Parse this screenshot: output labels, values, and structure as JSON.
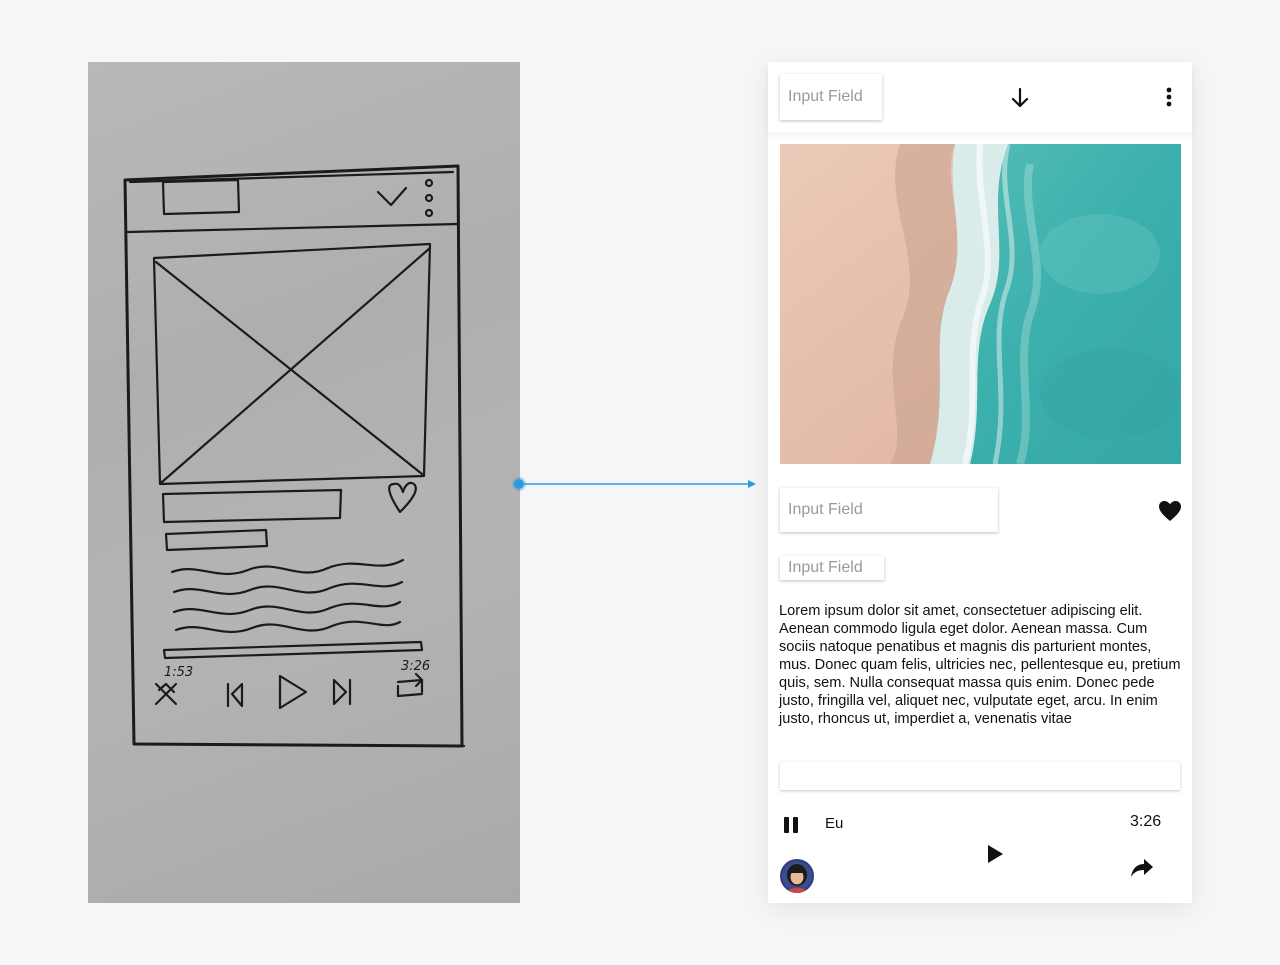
{
  "mockup": {
    "header": {
      "input_placeholder": "Input Field",
      "download_icon": "arrow-down-icon",
      "menu_icon": "more-vertical-icon"
    },
    "title_field": {
      "placeholder": "Input Field"
    },
    "subtitle_field": {
      "placeholder": "Input Field"
    },
    "like_icon": "heart-icon",
    "description": "Lorem ipsum dolor sit amet, consectetuer adipiscing elit. Aenean commodo ligula eget dolor. Aenean massa. Cum sociis natoque penatibus et magnis dis parturient montes, mus. Donec quam felis, ultricies nec, pellentesque eu, pretium quis, sem. Nulla consequat massa quis enim. Donec pede justo, fringilla vel, aliquet nec, vulputate eget, arcu. In enim justo, rhoncus ut, imperdiet a, venenatis vitae",
    "player": {
      "elapsed_label": "Eu",
      "duration": "3:26",
      "pause_icon": "pause-icon",
      "play_icon": "play-icon",
      "share_icon": "share-icon",
      "avatar_icon": "avatar"
    }
  },
  "sketch": {
    "elapsed": "1:53",
    "duration": "3:26"
  },
  "colors": {
    "page_background": "#f5f6f8",
    "connector": "#2d9cdb",
    "placeholder_text": "#9a9a9a",
    "sea": "#3fb2ac",
    "sand": "#e7c3b3"
  }
}
